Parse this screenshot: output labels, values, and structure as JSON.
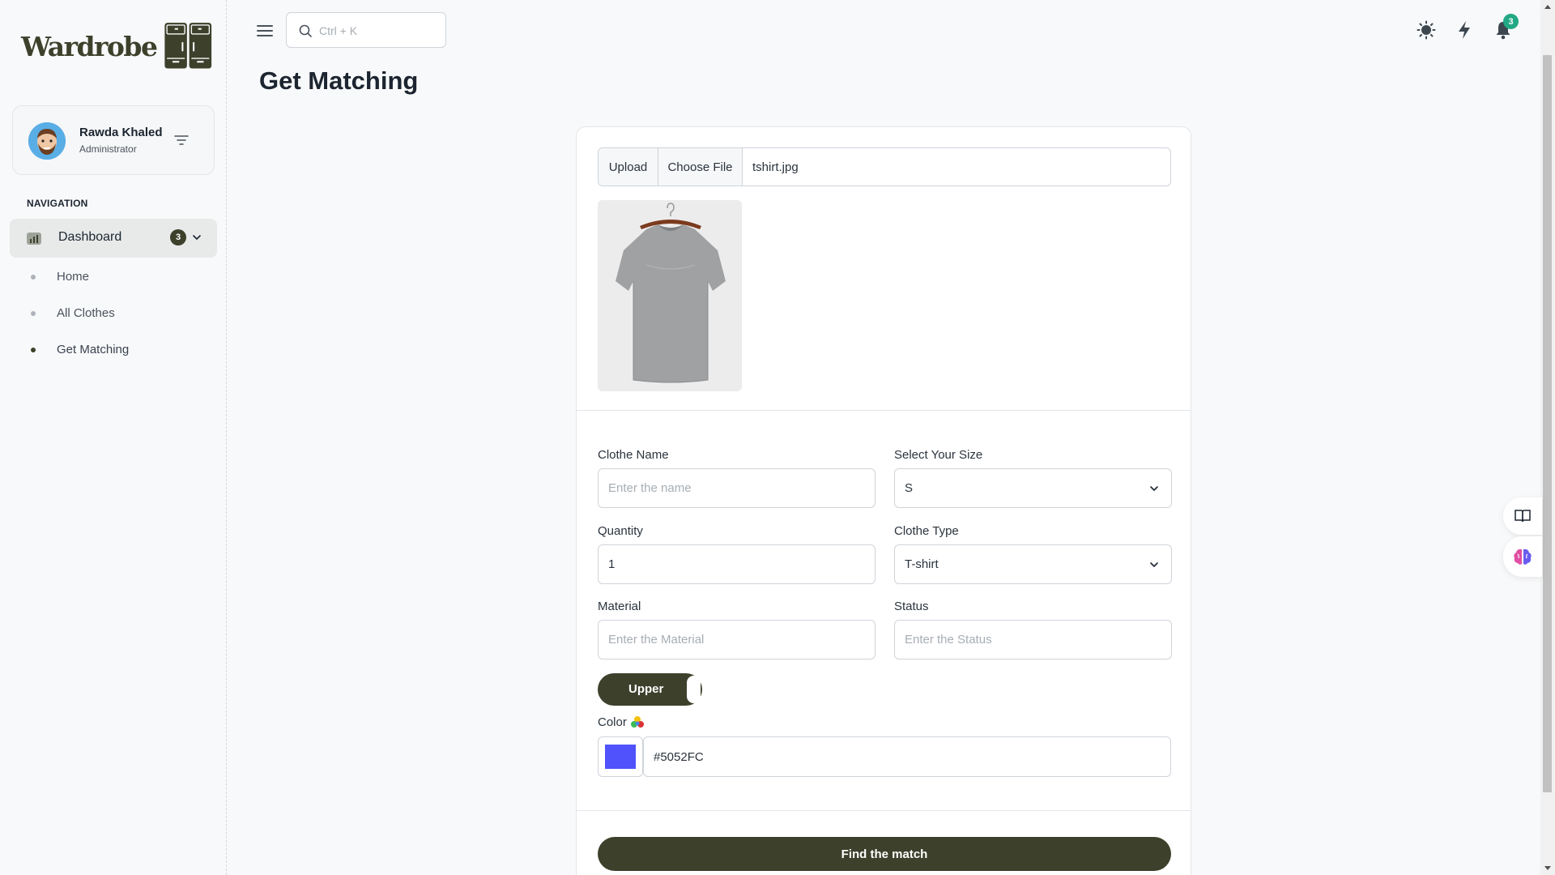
{
  "brand": {
    "logo_text": "Wardrobe",
    "color": "#3d402b"
  },
  "user": {
    "name": "Rawda Khaled",
    "role": "Administrator"
  },
  "sidebar": {
    "caption": "NAVIGATION",
    "dashboard": {
      "label": "Dashboard",
      "badge": "3",
      "icon": "dashboard-icon"
    },
    "items": [
      {
        "label": "Home",
        "active": false
      },
      {
        "label": "All Clothes",
        "active": false
      },
      {
        "label": "Get Matching",
        "active": true
      }
    ]
  },
  "topbar": {
    "search_placeholder": "Ctrl + K",
    "icons": [
      "theme-sun-icon",
      "flash-icon",
      "bell-icon"
    ],
    "notification_count": "3"
  },
  "page": {
    "title": "Get Matching"
  },
  "form": {
    "upload_label": "Upload",
    "choose_file": "Choose File",
    "file_name": "tshirt.jpg",
    "clothe_name": {
      "label": "Clothe Name",
      "placeholder": "Enter the name",
      "value": ""
    },
    "size": {
      "label": "Select Your Size",
      "value": "S"
    },
    "quantity": {
      "label": "Quantity",
      "value": "1"
    },
    "clothe_type": {
      "label": "Clothe Type",
      "value": "T-shirt"
    },
    "material": {
      "label": "Material",
      "placeholder": "Enter the Material",
      "value": ""
    },
    "status": {
      "label": "Status",
      "placeholder": "Enter the Status",
      "value": ""
    },
    "toggle": {
      "label": "Upper",
      "on": true
    },
    "color": {
      "label": "Color",
      "value": "#5052FC"
    },
    "submit": "Find the match"
  },
  "colors": {
    "accent": "#3d402b",
    "notification": "#22a884",
    "swatch": "#5052FC"
  }
}
